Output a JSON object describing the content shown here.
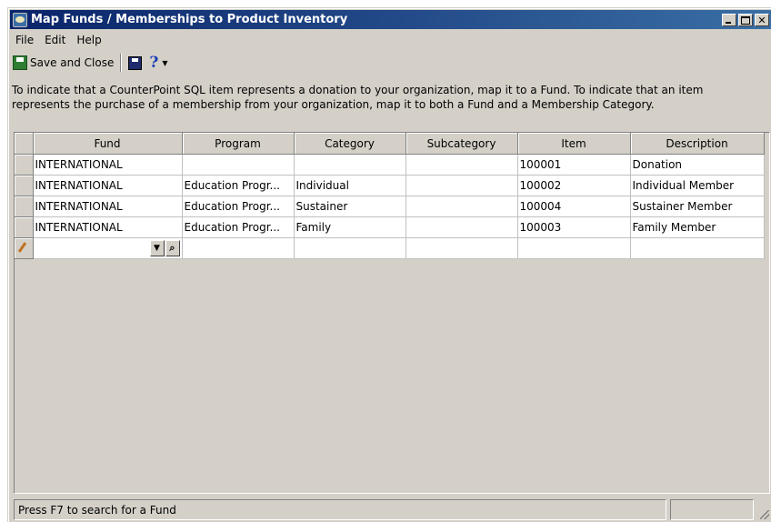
{
  "window": {
    "title": "Map Funds / Memberships to Product Inventory",
    "controls": [
      "minimize",
      "maximize",
      "close"
    ]
  },
  "menu": [
    "File",
    "Edit",
    "Help"
  ],
  "toolbar": {
    "save_close_label": "Save and Close",
    "save_icon": "floppy-disk-icon",
    "help_label": "?",
    "help_dropdown": "▼"
  },
  "info_text": "To indicate that a CounterPoint SQL item represents a donation to your organization, map it to a Fund.  To indicate that an item represents the purchase of a membership from your organization, map it to both a Fund and a Membership Category.",
  "grid": {
    "columns": [
      "Fund",
      "Program",
      "Category",
      "Subcategory",
      "Item",
      "Description"
    ],
    "rows": [
      {
        "fund": "INTERNATIONAL",
        "program": "",
        "category": "",
        "subcategory": "",
        "item": "100001",
        "description": "Donation"
      },
      {
        "fund": "INTERNATIONAL",
        "program": "Education Progr...",
        "category": "Individual",
        "subcategory": "",
        "item": "100002",
        "description": "Individual Member"
      },
      {
        "fund": "INTERNATIONAL",
        "program": "Education Progr...",
        "category": "Sustainer",
        "subcategory": "",
        "item": "100004",
        "description": "Sustainer Member"
      },
      {
        "fund": "INTERNATIONAL",
        "program": "Education Progr...",
        "category": "Family",
        "subcategory": "",
        "item": "100003",
        "description": "Family Member"
      }
    ],
    "new_row": {
      "fund": "",
      "combo_arrow": "▼",
      "find_glyph": "⌕"
    }
  },
  "status": {
    "message": "Press F7 to search for a Fund",
    "panel2": ""
  }
}
